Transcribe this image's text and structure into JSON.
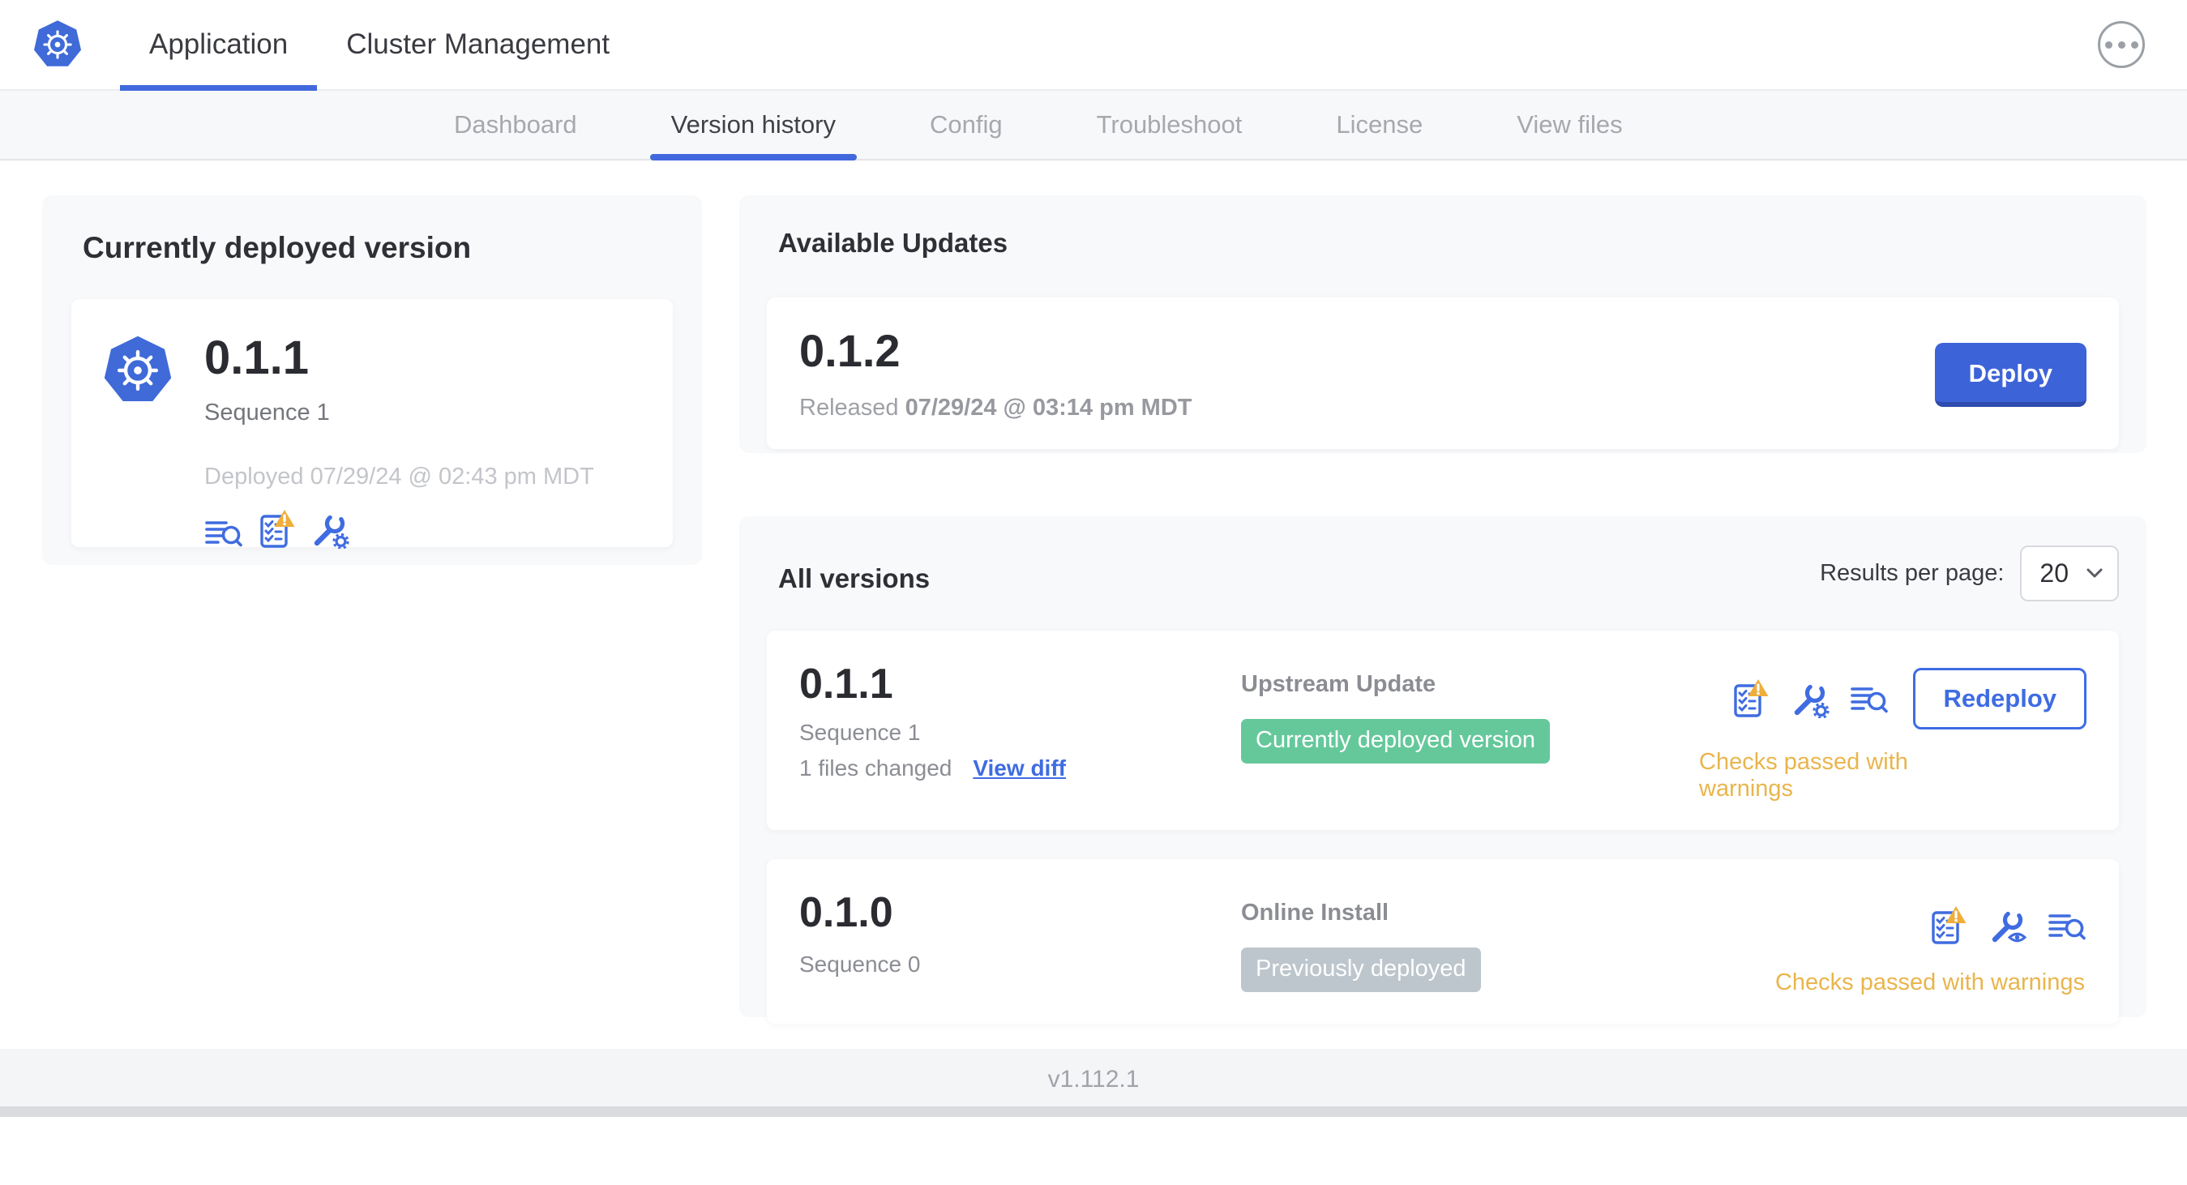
{
  "header": {
    "tabs": [
      {
        "label": "Application",
        "active": true
      },
      {
        "label": "Cluster Management",
        "active": false
      }
    ],
    "menu_icon": "ellipsis-circle"
  },
  "subnav": {
    "tabs": [
      {
        "label": "Dashboard",
        "active": false
      },
      {
        "label": "Version history",
        "active": true
      },
      {
        "label": "Config",
        "active": false
      },
      {
        "label": "Troubleshoot",
        "active": false
      },
      {
        "label": "License",
        "active": false
      },
      {
        "label": "View files",
        "active": false
      }
    ]
  },
  "deployed_card": {
    "title": "Currently deployed version",
    "version": "0.1.1",
    "sequence": "Sequence 1",
    "deployed_at": "Deployed 07/29/24 @ 02:43 pm MDT",
    "icons": [
      "deploy-logs-icon",
      "preflight-checks-warning-icon",
      "edit-config-icon"
    ]
  },
  "available_updates": {
    "title": "Available Updates",
    "version": "0.1.2",
    "released_label": "Released",
    "released_at": "07/29/24 @ 03:14 pm MDT",
    "deploy_label": "Deploy"
  },
  "all_versions": {
    "title": "All versions",
    "results_per_page_label": "Results per page:",
    "results_per_page_value": "20",
    "rows": [
      {
        "version": "0.1.1",
        "sequence": "Sequence 1",
        "files_changed": "1 files changed",
        "view_diff_label": "View diff",
        "source": "Upstream Update",
        "badge": "Currently deployed version",
        "badge_color": "#65c89b",
        "status": "Checks passed with warnings",
        "action_label": "Redeploy",
        "icons": [
          "preflight-checks-warning-icon",
          "edit-config-icon",
          "deploy-logs-icon"
        ]
      },
      {
        "version": "0.1.0",
        "sequence": "Sequence 0",
        "source": "Online Install",
        "badge": "Previously deployed",
        "badge_color": "#bdc6cc",
        "status": "Checks passed with warnings",
        "icons": [
          "preflight-checks-warning-icon",
          "view-config-icon",
          "deploy-logs-icon"
        ]
      }
    ]
  },
  "footer": {
    "version": "v1.112.1"
  },
  "colors": {
    "accent_blue": "#3e6ce2",
    "kubernetes_blue": "#3f6ad8",
    "deploy_button": "#3d63d8",
    "success_green": "#65c89b",
    "neutral_badge_gray": "#bdc6cc",
    "warning_text": "#e9b54c",
    "warning_triangle": "#efae3b",
    "subnav_background": "#f7f8fa",
    "panel_background": "#f8f9fb"
  }
}
